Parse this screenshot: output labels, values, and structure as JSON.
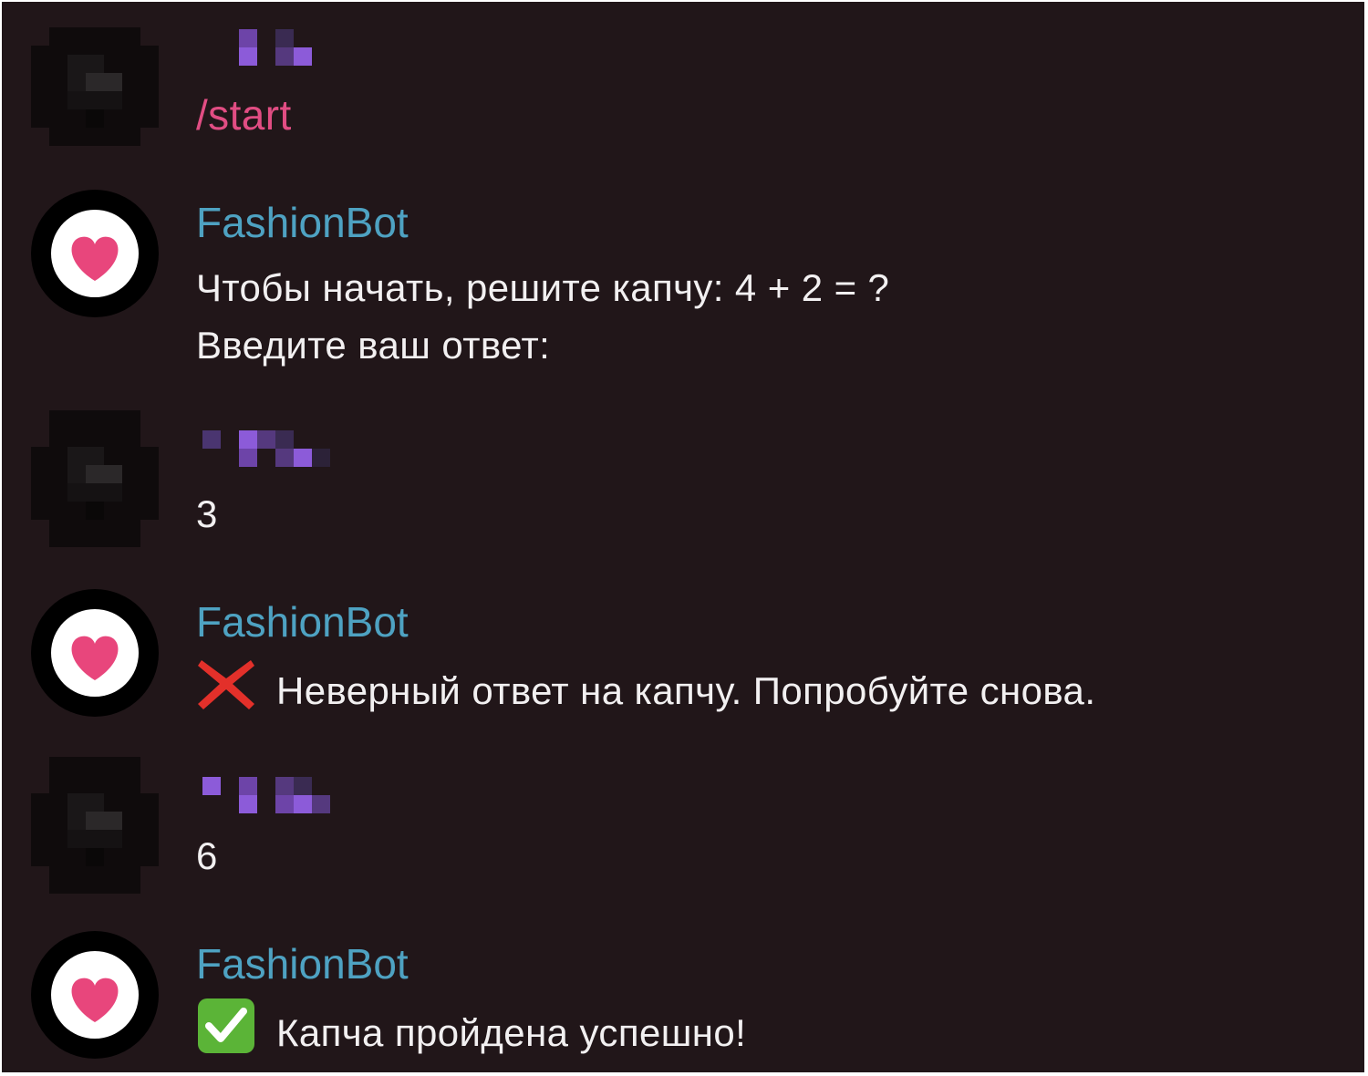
{
  "chat": {
    "bot_name": "FashionBot",
    "messages": [
      {
        "sender": "user",
        "text": "/start"
      },
      {
        "sender": "bot",
        "line1": "Чтобы начать, решите капчу: 4 + 2 = ?",
        "line2": "Введите ваш ответ:"
      },
      {
        "sender": "user",
        "text": "3"
      },
      {
        "sender": "bot",
        "icon": "cross-mark-icon",
        "text": "Неверный ответ на капчу. Попробуйте снова."
      },
      {
        "sender": "user",
        "text": "6"
      },
      {
        "sender": "bot",
        "icon": "check-mark-button-icon",
        "text": "Капча пройдена успешно!"
      }
    ]
  },
  "colors": {
    "background": "#211619",
    "command_text": "#e14d83",
    "bot_name": "#4ea2c2",
    "message_text": "#f2f0f1",
    "heart": "#e8467c",
    "redacted_name": "#8c5bd9"
  }
}
